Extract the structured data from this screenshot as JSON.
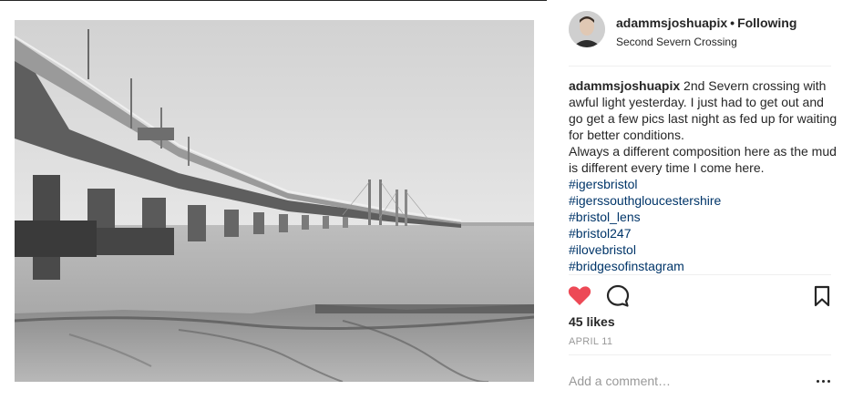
{
  "post": {
    "username": "adammsjoshuapix",
    "separator": "•",
    "follow_status": "Following",
    "location": "Second Severn Crossing",
    "photo_subject": "black and white photo of the Second Severn Crossing bridge over the estuary at low tide",
    "caption": {
      "user": "adammsjoshuapix",
      "text_1": " 2nd Severn crossing with awful light yesterday. I just had to get out and go get a few pics last night as fed up for waiting for better conditions.",
      "text_2": "Always a different composition here as the mud is different every time I come here."
    },
    "hashtags": [
      "#igersbristol",
      "#igerssouthgloucestershire",
      "#bristol_lens",
      "#bristol247",
      "#ilovebristol",
      "#bridgesofinstagram"
    ],
    "likes": "45 likes",
    "date": "APRIL 11",
    "comment_placeholder": "Add a comment…",
    "icons": {
      "like": "heart-icon",
      "comment": "comment-icon",
      "save": "bookmark-icon",
      "more": "more-options-icon"
    },
    "colors": {
      "heart": "#ed4956",
      "hashtag": "#003569",
      "text": "#262626",
      "muted": "#999999"
    }
  }
}
